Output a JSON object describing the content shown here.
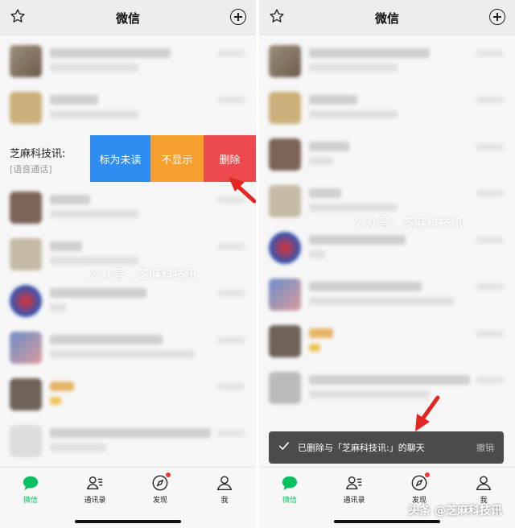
{
  "left": {
    "header": {
      "title": "微信"
    },
    "swipe_row": {
      "name": "芝麻科技讯:",
      "subtitle": "[语音通话]"
    },
    "actions": {
      "mark_unread": "标为未读",
      "hide": "不显示",
      "delete": "删除"
    },
    "watermark": "公众号：芝麻科技讯"
  },
  "right": {
    "header": {
      "title": "微信"
    },
    "watermark": "公众号：芝麻科技讯",
    "toast": {
      "message": "已删除与「芝麻科技讯:」的聊天",
      "undo": "撤销"
    }
  },
  "tabbar": {
    "items": [
      {
        "label": "微信",
        "icon": "chat-bubble-icon",
        "active": true
      },
      {
        "label": "通讯录",
        "icon": "contacts-icon"
      },
      {
        "label": "发现",
        "icon": "compass-icon",
        "badge": true
      },
      {
        "label": "我",
        "icon": "person-icon"
      }
    ]
  },
  "branding": "头条 @芝麻科技讯",
  "colors": {
    "accent_green": "#07c160",
    "mark_unread": "#2f8cf0",
    "hide": "#f6a02d",
    "delete": "#ec4a4f",
    "arrow_red": "#e52521"
  }
}
